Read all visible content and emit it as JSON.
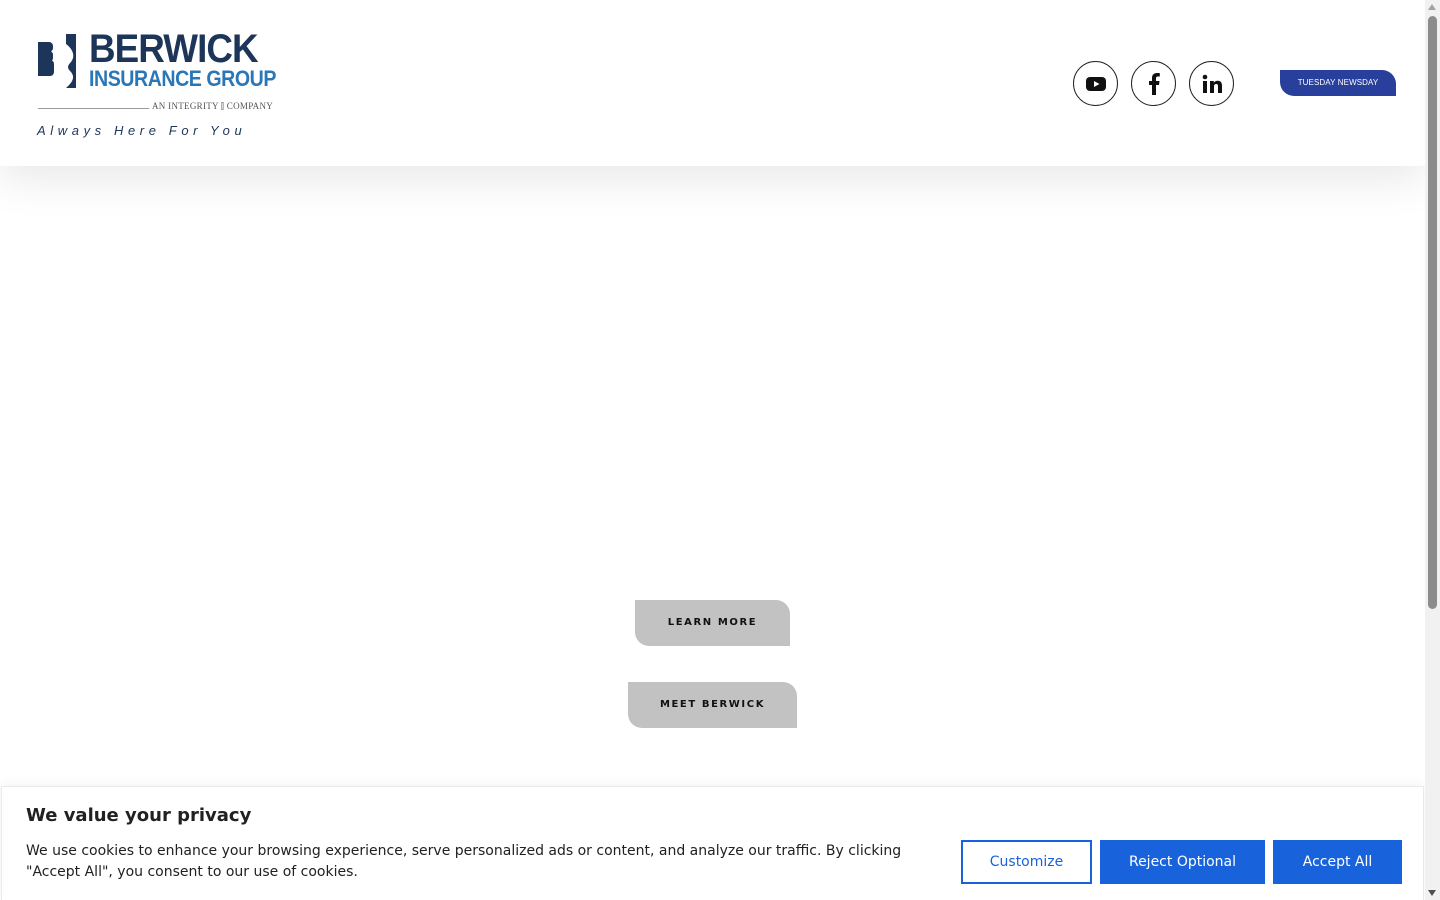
{
  "header": {
    "logo": {
      "name": "BERWICK",
      "sub": "INSURANCE GROUP",
      "integrity": "AN INTEGRITY ⫿ COMPANY",
      "tagline": "Always Here For You",
      "color_primary": "#1d3559",
      "color_secondary": "#2a77b8"
    },
    "social": [
      {
        "icon": "youtube-icon"
      },
      {
        "icon": "facebook-icon"
      },
      {
        "icon": "linkedin-icon"
      }
    ],
    "newsday_label": "TUESDAY NEWSDAY",
    "newsday_color": "#283f9b"
  },
  "hero": {
    "learn_more_label": "LEARN MORE",
    "meet_label": "MEET BERWICK",
    "button_color": "#c2c2c2"
  },
  "cookie": {
    "title": "We value your privacy",
    "text": "We use cookies to enhance your browsing experience, serve personalized ads or content, and analyze our traffic. By clicking \"Accept All\", you consent to our use of cookies.",
    "customize_label": "Customize",
    "reject_label": "Reject Optional",
    "accept_label": "Accept All",
    "accent_color": "#1863dc"
  }
}
